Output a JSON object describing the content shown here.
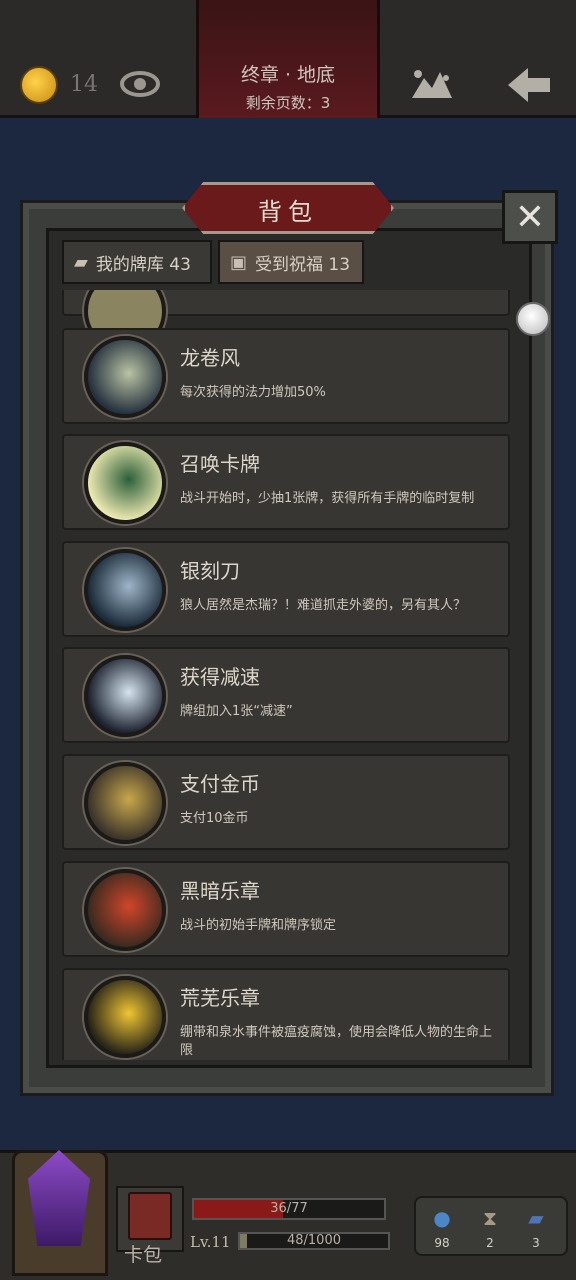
{
  "header": {
    "coins": "14",
    "chapter_title": "终章 · 地底",
    "pages_left": "剩余页数：3"
  },
  "panel": {
    "title": "背包",
    "tabs": [
      {
        "label": "我的牌库 43"
      },
      {
        "label": "受到祝福 13"
      }
    ],
    "items": [
      {
        "name": "龙卷风",
        "desc": "每次获得的法力增加50%",
        "colors": [
          "#26323f",
          "#b9c3a4"
        ]
      },
      {
        "name": "召唤卡牌",
        "desc": "战斗开始时，少抽1张牌，获得所有手牌的临时复制",
        "colors": [
          "#eae7b0",
          "#2c5f3a"
        ]
      },
      {
        "name": "银刻刀",
        "desc": "狼人居然是杰瑞？！难道抓走外婆的，另有其人？",
        "colors": [
          "#1b2b3a",
          "#9fb6c8"
        ]
      },
      {
        "name": "获得减速",
        "desc": "牌组加入1张“减速”",
        "colors": [
          "#1e2330",
          "#d4e4f0"
        ]
      },
      {
        "name": "支付金币",
        "desc": "支付10金币",
        "colors": [
          "#3b342a",
          "#c9a84a"
        ]
      },
      {
        "name": "黑暗乐章",
        "desc": "战斗的初始手牌和牌序锁定",
        "colors": [
          "#3d2a1f",
          "#d1462a"
        ]
      },
      {
        "name": "荒芜乐章",
        "desc": "绷带和泉水事件被瘟疫腐蚀，使用会降低人物的生命上限",
        "colors": [
          "#2a2719",
          "#f0c534"
        ]
      }
    ]
  },
  "footer": {
    "deck_label": "卡包",
    "hp_text": "36/77",
    "hp_fraction": 0.4675,
    "level_label": "Lv.11",
    "xp_text": "48/1000",
    "xp_fraction": 0.048,
    "stats": [
      {
        "icon": "mana-orb-icon",
        "value": "98"
      },
      {
        "icon": "hourglass-icon",
        "value": "2"
      },
      {
        "icon": "cards-icon",
        "value": "3"
      }
    ]
  }
}
